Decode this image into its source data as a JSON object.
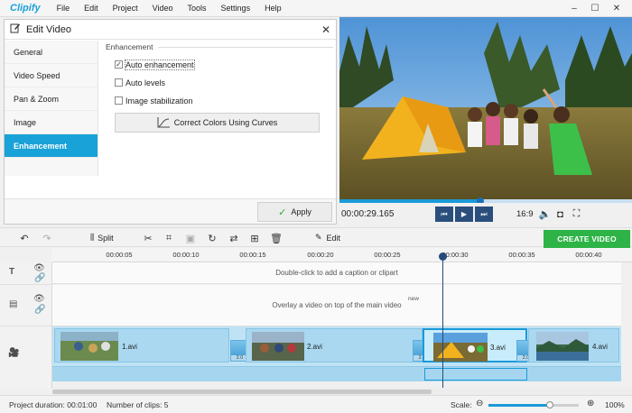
{
  "app": {
    "logo": "Clipify",
    "menu": [
      "File",
      "Edit",
      "Project",
      "Video",
      "Tools",
      "Settings",
      "Help"
    ]
  },
  "edit_panel": {
    "title": "Edit Video",
    "sidebar": [
      "General",
      "Video Speed",
      "Pan & Zoom",
      "Image",
      "Enhancement"
    ],
    "active_index": 4,
    "section_title": "Enhancement",
    "options": [
      {
        "label": "Auto enhancement",
        "checked": true
      },
      {
        "label": "Auto levels",
        "checked": false
      },
      {
        "label": "Image stabilization",
        "checked": false
      }
    ],
    "curves_button": "Correct Colors Using Curves",
    "apply_button": "Apply"
  },
  "player": {
    "timecode": "00:00:29.165",
    "progress": 0.48,
    "aspect_ratio": "16:9"
  },
  "toolbar": {
    "split_label": "Split",
    "edit_label": "Edit",
    "create_button": "CREATE VIDEO"
  },
  "timeline": {
    "ticks": [
      "00:00:05",
      "00:00:10",
      "00:00:15",
      "00:00:20",
      "00:00:25",
      "00:00:30",
      "00:00:35",
      "00:00:40"
    ],
    "caption_hint": "Double-click to add a caption or clipart",
    "overlay_hint": "Overlay a video on top of the main video",
    "new_badge": "new",
    "clips": [
      "1.avi",
      "2.avi",
      "3.avi",
      "4.avi"
    ],
    "transitions": [
      "2.0",
      "2.0",
      "2.0"
    ]
  },
  "status": {
    "project_duration": "Project duration:  00:01:00",
    "clip_count": "Number of clips: 5",
    "scale_label": "Scale:",
    "zoom_value": "100%",
    "zoom_level": 0.68
  },
  "colors": {
    "accent": "#19a2d8",
    "create": "#2eb347",
    "player_button": "#2a4f7d"
  }
}
